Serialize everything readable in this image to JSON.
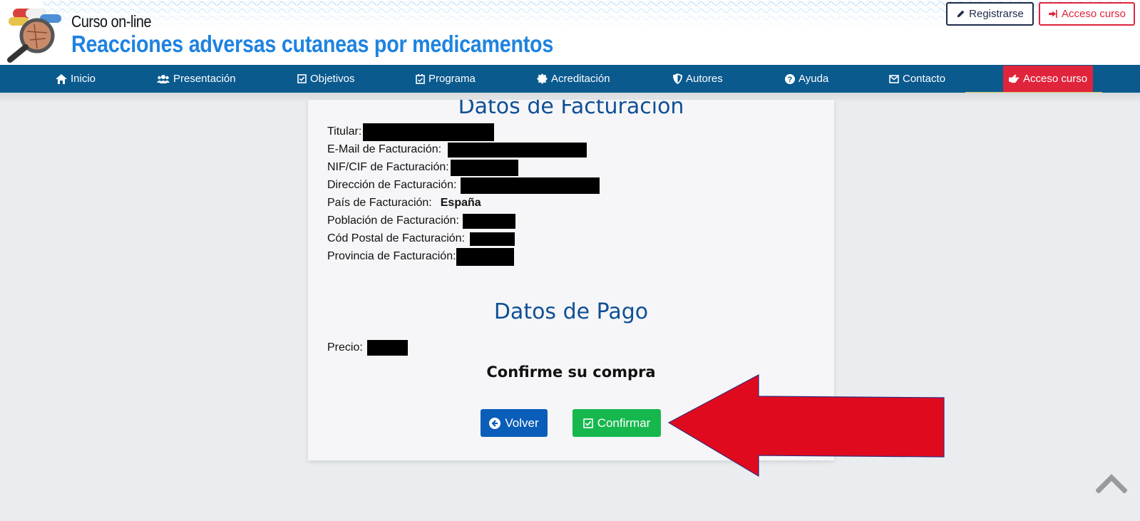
{
  "header": {
    "brand_small": "Curso on-line",
    "brand_big": "Reacciones adversas cutaneas por medicamentos",
    "register_label": "Registrarse",
    "access_label": "Acceso curso"
  },
  "nav": {
    "items": [
      {
        "label": "Inicio",
        "icon": "home-icon"
      },
      {
        "label": "Presentación",
        "icon": "users-icon"
      },
      {
        "label": "Objetivos",
        "icon": "check-square-icon"
      },
      {
        "label": "Programa",
        "icon": "calendar-check-icon"
      },
      {
        "label": "Acreditación",
        "icon": "certificate-icon"
      },
      {
        "label": "Autores",
        "icon": "shield-icon"
      },
      {
        "label": "Ayuda",
        "icon": "question-circle-icon"
      },
      {
        "label": "Contacto",
        "icon": "envelope-icon"
      },
      {
        "label": "Acceso curso",
        "icon": "hand-point-icon"
      }
    ]
  },
  "billing": {
    "title": "Datos de Facturación",
    "titular_label": "Titular:",
    "email_label": "E-Mail de Facturación:",
    "nif_label": "NIF/CIF de Facturación:",
    "address_label": "Dirección de Facturación:",
    "country_label": "País de Facturación:",
    "country_value": "España",
    "city_label": "Población de Facturación:",
    "zip_label": "Cód Postal de Facturación:",
    "province_label": "Provincia de Facturación:"
  },
  "payment": {
    "title": "Datos de Pago",
    "price_label": "Precio:"
  },
  "confirm": {
    "prompt": "Confirme su compra",
    "back_label": "Volver",
    "confirm_label": "Confirmar"
  },
  "colors": {
    "navbar": "#0a5a8e",
    "accent_red": "#e0243c",
    "brand_blue": "#1f83e0",
    "title_blue": "#0f4f96",
    "back_button": "#0a5db8",
    "confirm_button": "#16b84e",
    "arrow": "#e00a1e"
  }
}
